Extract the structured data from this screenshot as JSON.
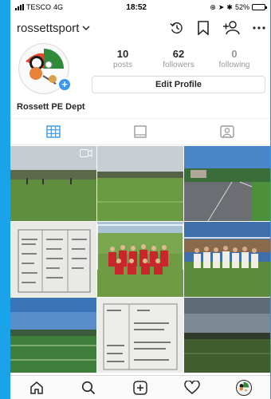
{
  "status_bar": {
    "carrier": "TESCO",
    "network": "4G",
    "time": "18:52",
    "battery": "52%",
    "battery_level": 0.52
  },
  "header": {
    "username": "rossettsport",
    "icons": [
      "chevron-down-icon",
      "archive-icon",
      "bookmark-icon",
      "discover-people-icon",
      "more-icon"
    ]
  },
  "profile": {
    "stats": [
      {
        "value": "10",
        "label": "posts"
      },
      {
        "value": "62",
        "label": "followers"
      },
      {
        "value": "0",
        "label": "following"
      }
    ],
    "edit_label": "Edit Profile",
    "display_name": "Rossett PE Dept"
  },
  "view_tabs": [
    "grid-icon",
    "portrait-icon",
    "tagged-icon"
  ],
  "grid": [
    {
      "kind": "field",
      "badge": "video-icon"
    },
    {
      "kind": "field"
    },
    {
      "kind": "track"
    },
    {
      "kind": "whiteboard"
    },
    {
      "kind": "team-red"
    },
    {
      "kind": "team-white"
    },
    {
      "kind": "field-dusk"
    },
    {
      "kind": "whiteboard-fixtures"
    },
    {
      "kind": "field-dark"
    }
  ],
  "tab_bar": [
    "home-icon",
    "search-icon",
    "new-post-icon",
    "activity-icon",
    "profile-icon"
  ],
  "colors": {
    "accent": "#3897f0",
    "background": "#1aa3e8",
    "text": "#262626",
    "muted": "#999999"
  }
}
